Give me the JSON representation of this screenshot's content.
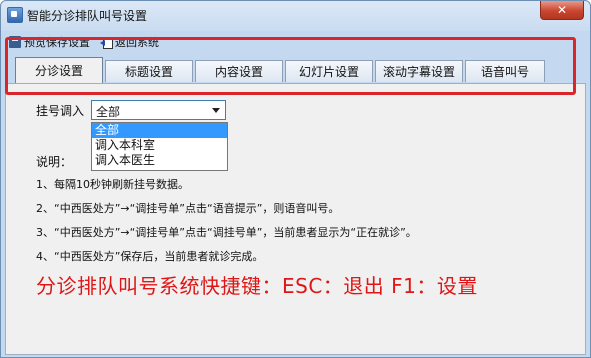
{
  "window": {
    "title": "智能分诊排队叫号设置",
    "close_label": "✕"
  },
  "toolbar": {
    "save_label": "预览保存设置",
    "back_label": "返回系统"
  },
  "tabs": [
    {
      "label": "分诊设置",
      "active": true
    },
    {
      "label": "标题设置",
      "active": false
    },
    {
      "label": "内容设置",
      "active": false
    },
    {
      "label": "幻灯片设置",
      "active": false
    },
    {
      "label": "滚动字幕设置",
      "active": false
    },
    {
      "label": "语音叫号",
      "active": false
    }
  ],
  "form": {
    "register_label": "挂号调入",
    "register_value": "全部",
    "options": [
      "全部",
      "调入本科室",
      "调入本医生"
    ]
  },
  "notes": {
    "heading": "说明：",
    "items": [
      "1、每隔10秒钟刷新挂号数据。",
      "2、“中西医处方”→“调挂号单”点击“语音提示”，则语音叫号。",
      "3、“中西医处方”→“调挂号单”点击“调挂号单”，当前患者显示为“正在就诊”。",
      "4、“中西医处方”保存后，当前患者就诊完成。"
    ]
  },
  "shortcut_text": "分诊排队叫号系统快捷键：ESC：退出    F1：设置",
  "colors": {
    "highlight": "#d8262b",
    "shortcut": "#e01616",
    "selection": "#3399ff"
  }
}
